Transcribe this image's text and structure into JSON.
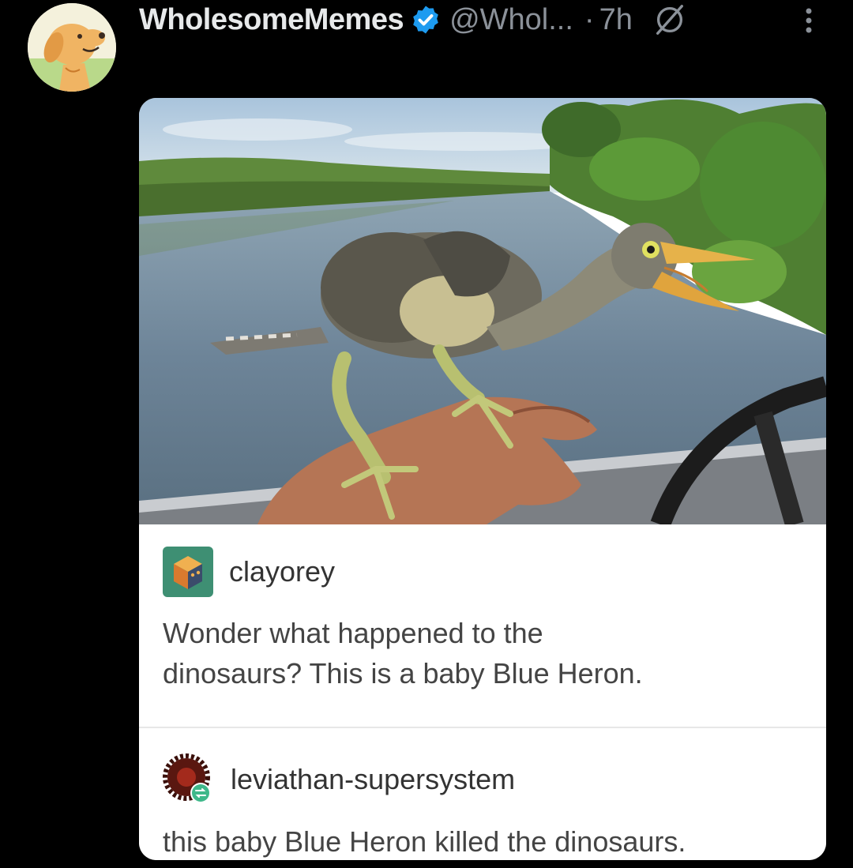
{
  "tweet": {
    "display_name": "WholesomeMemes",
    "handle": "@Whol...",
    "separator": "·",
    "time": "7h",
    "avatar_icon": "golden-retriever-avatar",
    "verified_color": "#1d9bf0"
  },
  "media": {
    "image_description_icon": "baby-heron-photo",
    "posts": [
      {
        "username": "clayorey",
        "avatar_icon": "cube-avatar",
        "text_line1": "Wonder what happened to the",
        "text_line2": "dinosaurs? This is a baby Blue Heron."
      },
      {
        "username": "leviathan-supersystem",
        "avatar_icon": "gear-avatar",
        "text": "this baby Blue Heron killed the dinosaurs."
      }
    ]
  }
}
